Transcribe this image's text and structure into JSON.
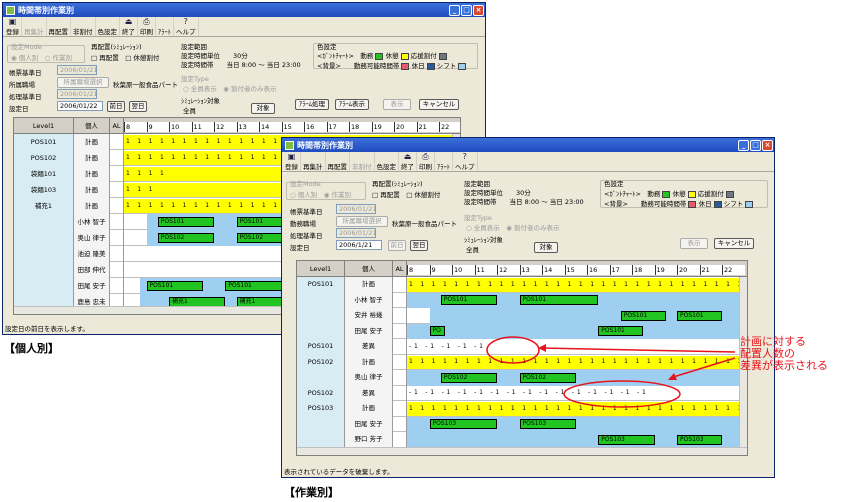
{
  "win1": {
    "title": "時間帯別作業別",
    "toolbar": [
      {
        "icon": "save-icon",
        "label": "登録",
        "disabled": false
      },
      {
        "icon": "",
        "label": "再集計",
        "disabled": true
      },
      {
        "icon": "",
        "label": "再配置",
        "disabled": false
      },
      {
        "icon": "",
        "label": "非割付",
        "disabled": false
      },
      {
        "icon": "",
        "label": "色設定",
        "disabled": false
      },
      {
        "icon": "exit-icon",
        "label": "終了",
        "disabled": false
      },
      {
        "icon": "print-icon",
        "label": "印刷",
        "disabled": false
      },
      {
        "icon": "",
        "label": "ｱﾗｰﾄ",
        "disabled": false
      },
      {
        "icon": "help-icon",
        "label": "ヘルプ",
        "disabled": false
      }
    ],
    "mode_title": "設定Mode",
    "mode_opts": "◉ 個人別　○ 作業別",
    "rearr_title": "再配置(ｼﾐｭﾚｰｼｮﾝ)",
    "rearr_opts": "□ 再配置　□ 休憩割付",
    "range_title": "設定範囲",
    "range_l1": "設定時間単位　　30分",
    "range_l2": "設定時間帯　　当日 8:00 ～ 当日 23:00",
    "color_title": "色設定",
    "color_l1": "<ｶﾞﾝﾄﾁｬｰﾄ>　動務",
    "color_l1b": "休憩",
    "color_l1c": "応援割付",
    "color_l2": "<背景>　　動務可能時間帯",
    "color_l2b": "休日",
    "color_l2c": "シフト",
    "date1_label": "帳票基準日",
    "date1_value": "2006/01/21",
    "dept_label": "所属職場",
    "dept_btn": "所属職場選択",
    "dept_value": "秋葉原一般食品パート",
    "proc_label": "処理基準日",
    "proc_value": "2006/01/21",
    "set_label": "設定日",
    "set_value": "2006/01/22",
    "prev_btn": "前日",
    "next_btn": "翌日",
    "type_title": "設定Type",
    "type_opts": "○ 全員表示　◉ 割付者のみ表示",
    "sim_title": "ｼﾐｭﾚｰｼｮﾝ対象",
    "sim_value": "全員",
    "sim_btn": "対象",
    "alarm_btn": "ｱﾗｰﾑ処理",
    "alarm_show_btn": "ｱﾗｰﾑ表示",
    "show_btn": "表示",
    "cancel_btn": "キャンセル",
    "headers": {
      "level": "Level1",
      "person": "個人",
      "al": "AL"
    },
    "hours": [
      "8",
      "9",
      "10",
      "11",
      "12",
      "13",
      "14",
      "15",
      "16",
      "17",
      "18",
      "19",
      "20",
      "21",
      "22"
    ],
    "rows": [
      {
        "level": "POS101",
        "person": "計画",
        "digits": "1 1 1 1 1 1 1 1 1 1 1 1 1 1 1 1 1 1 1 1 1 1 1 1 1 1 1 1 1 1"
      },
      {
        "level": "POS102",
        "person": "計画",
        "digits": "1 1 1 1 1 1 1 1 1 1 1 1 1 1 1 1 1 1 1 1 1 1 1 1 1 1 1 1 1 1"
      },
      {
        "level": "袋麺101",
        "person": "計画",
        "digits": "                  1 1 1 1"
      },
      {
        "level": "袋麺103",
        "person": "計画",
        "digits": "                    1 1 1"
      },
      {
        "level": "補充1",
        "person": "計画",
        "digits": "1 1 1 1 1 1 1 1 1 1 1 1 1 1 1 1 1 1 1 1 1 1 1 1 1 1 1 1 1 1"
      },
      {
        "level": "",
        "person": "小林 智子",
        "shifts": [
          "POS101",
          "POS101"
        ]
      },
      {
        "level": "",
        "person": "奥山 律子",
        "shifts": [
          "POS102",
          "POS102"
        ]
      },
      {
        "level": "",
        "person": "池迫 隆美",
        "shifts": []
      },
      {
        "level": "",
        "person": "田部 伸代",
        "shifts": []
      },
      {
        "level": "",
        "person": "田尾 安子",
        "shifts": [
          "POS101",
          "POS101"
        ]
      },
      {
        "level": "",
        "person": "鹿島 忠未",
        "shifts": [
          "補充1",
          "補充1"
        ]
      }
    ],
    "status": "設定日の前日を表示します。"
  },
  "win2": {
    "title": "時間帯別作業別",
    "toolbar": [
      {
        "icon": "save-icon",
        "label": "登録",
        "disabled": false
      },
      {
        "icon": "",
        "label": "再集計",
        "disabled": false
      },
      {
        "icon": "",
        "label": "再配置",
        "disabled": false
      },
      {
        "icon": "",
        "label": "非割付",
        "disabled": true
      },
      {
        "icon": "",
        "label": "色設定",
        "disabled": false
      },
      {
        "icon": "exit-icon",
        "label": "終了",
        "disabled": false
      },
      {
        "icon": "print-icon",
        "label": "印刷",
        "disabled": false
      },
      {
        "icon": "",
        "label": "ｱﾗｰﾄ",
        "disabled": false
      },
      {
        "icon": "help-icon",
        "label": "ヘルプ",
        "disabled": false
      }
    ],
    "mode_title": "設定Mode",
    "mode_opts": "○ 個人別　◉ 作業別",
    "rearr_title": "再配置(ｼﾐｭﾚｰｼｮﾝ)",
    "rearr_opts": "□ 再配置　□ 休憩割付",
    "range_title": "設定範囲",
    "range_l1": "設定時間単位　　30分",
    "range_l2": "設定時間帯　　当日 8:00 ～ 当日 23:00",
    "color_title": "色設定",
    "color_l1": "<ｶﾞﾝﾄﾁｬｰﾄ>　動務",
    "color_l1b": "休憩",
    "color_l1c": "応援割付",
    "color_l2": "<背景>　　動務可能時間帯",
    "color_l2b": "休日",
    "color_l2c": "シフト",
    "date1_label": "帳票基準日",
    "date1_value": "2006/01/21",
    "dept_label": "動務職場",
    "dept_btn": "所属職場選択",
    "dept_value": "秋葉原一般食品パート",
    "proc_label": "処理基準日",
    "proc_value": "2006/01/21",
    "set_label": "設定日",
    "set_value": "2006/1/21",
    "prev_btn": "前日",
    "next_btn": "翌日",
    "type_title": "設定Type",
    "type_opts": "○ 全員表示　◉ 割付者のみ表示",
    "sim_title": "ｼﾐｭﾚｰｼｮﾝ対象",
    "sim_value": "全員",
    "sim_btn": "対象",
    "show_btn": "表示",
    "cancel_btn": "キャンセル",
    "headers": {
      "level": "Level1",
      "person": "個人",
      "al": "AL"
    },
    "hours": [
      "8",
      "9",
      "10",
      "11",
      "12",
      "13",
      "14",
      "15",
      "16",
      "17",
      "18",
      "19",
      "20",
      "21",
      "22"
    ],
    "rows": [
      {
        "level": "POS101",
        "person": "計画",
        "kind": "plan",
        "digits": "1 1 1 1 1 1 1 1 1 1 1 1 1 1 1 1 1 1 1 1 1 1 1 1 1 1 1 1 1 1"
      },
      {
        "level": "",
        "person": "小林 智子",
        "kind": "staff",
        "shifts": [
          "POS101",
          "POS101"
        ]
      },
      {
        "level": "",
        "person": "安井 裕幾",
        "kind": "staff",
        "shifts": [
          "POS101",
          "POS101"
        ]
      },
      {
        "level": "",
        "person": "田尾 安子",
        "kind": "staff",
        "shifts": [
          "PO",
          "POS101"
        ]
      },
      {
        "level": "POS101",
        "person": "差異",
        "kind": "diff",
        "digits": "-1  -1            -1  -1                          -1"
      },
      {
        "level": "POS102",
        "person": "計画",
        "kind": "plan",
        "digits": "1 1 1 1 1 1 1 1 1 1 1 1 1 1 1 1 1 1 1 1 1 1 1 1 1 1 1 1 1 1"
      },
      {
        "level": "",
        "person": "奥山 律子",
        "kind": "staff",
        "shifts": [
          "POS102",
          "POS102"
        ]
      },
      {
        "level": "POS102",
        "person": "差異",
        "kind": "diff",
        "digits": "-1  -1  -1          -1  -1          -1 -1 -1 -1 -1 -1 -1 -1 -1 -1"
      },
      {
        "level": "POS103",
        "person": "計画",
        "kind": "plan",
        "digits": "1 1 1 1 1 1 1 1 1 1 1 1 1 1 1 1 1 1 1 1 1 1 1 1 1 1 1 1 1 1"
      },
      {
        "level": "",
        "person": "田尾 安子",
        "kind": "staff",
        "shifts": [
          "POS103",
          "POS103"
        ]
      },
      {
        "level": "",
        "person": "野口 芳子",
        "kind": "staff",
        "shifts": [
          "POS103",
          "POS103"
        ]
      }
    ],
    "status": "表示されているデータを破棄します。"
  },
  "caption_personal": "【個人別】",
  "caption_task": "【作業別】",
  "annotation": [
    "計画に対する",
    "配置人数の",
    "差異が表示される"
  ],
  "colors": {
    "plan": "#ffff00",
    "shift": "#22c422",
    "bg_shift": "#9ecff0",
    "level": "#d8ecf4",
    "annot": "#e8141c"
  }
}
